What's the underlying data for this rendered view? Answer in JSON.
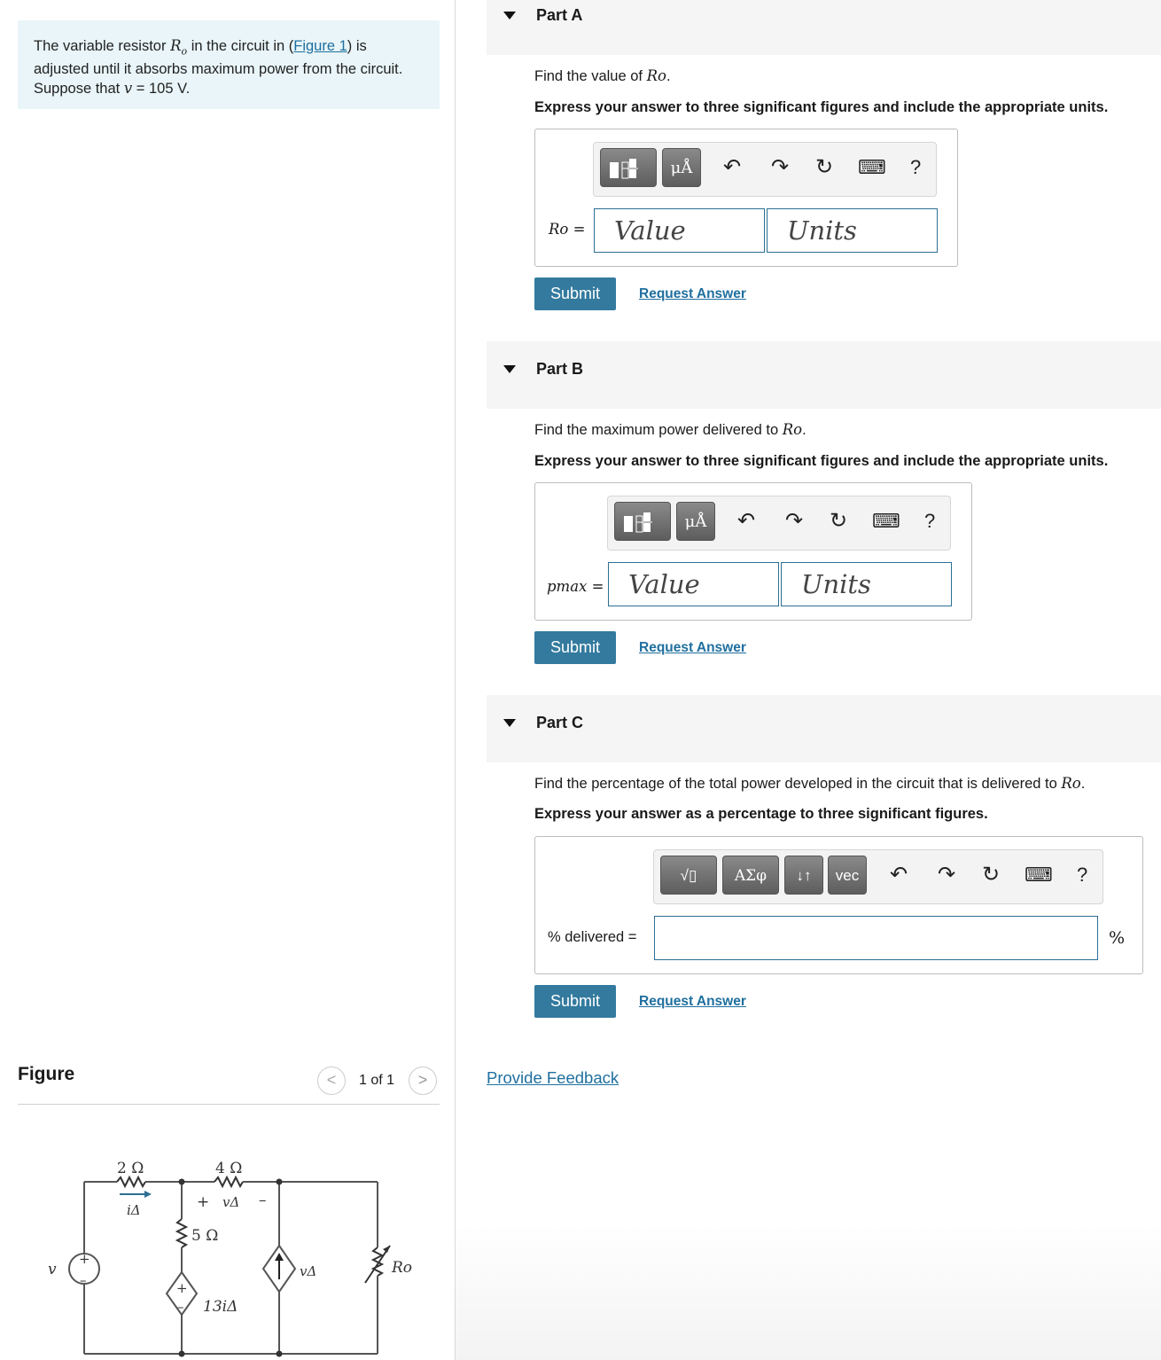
{
  "problem": {
    "text_1": "The variable resistor ",
    "var_R": "R",
    "var_R_sub": "o",
    "text_2": " in the circuit in (",
    "figure_link": "Figure 1",
    "text_3": ") is adjusted until it absorbs maximum power from the circuit. Suppose that ",
    "var_v": "v",
    "text_4": " = 105 V."
  },
  "figure": {
    "title": "Figure",
    "pager": "1 of 1",
    "prev_glyph": "<",
    "next_glyph": ">",
    "labels": {
      "r2": "2 Ω",
      "r4": "4 Ω",
      "r5": "5 Ω",
      "i_delta": "iΔ",
      "v_delta_plus": "+",
      "v_delta": "vΔ",
      "v_delta_minus": "–",
      "dep_src": "13iΔ",
      "v_src": "v",
      "cs_v": "vΔ",
      "ro": "Ro",
      "src_plus": "+",
      "src_minus": "–",
      "dep_plus": "+",
      "dep_minus": "–"
    }
  },
  "parts": [
    {
      "title": "Part A",
      "prompt": "Find the value of ",
      "prompt_var": "Ro",
      "prompt_end": ".",
      "instruction": "Express your answer to three significant figures and include the appropriate units.",
      "var_label": "Ro =",
      "value_placeholder": "Value",
      "units_placeholder": "Units",
      "submit": "Submit",
      "request": "Request Answer"
    },
    {
      "title": "Part B",
      "prompt": "Find the maximum power delivered to ",
      "prompt_var": "Ro",
      "prompt_end": ".",
      "instruction": "Express your answer to three significant figures and include the appropriate units.",
      "var_label": "pmax =",
      "value_placeholder": "Value",
      "units_placeholder": "Units",
      "submit": "Submit",
      "request": "Request Answer"
    },
    {
      "title": "Part C",
      "prompt": "Find the percentage of the total power developed in the circuit that is delivered to ",
      "prompt_var": "Ro",
      "prompt_end": ".",
      "instruction": "Express your answer as a percentage to three significant figures.",
      "var_label": "% delivered =",
      "unit_suffix": "%",
      "submit": "Submit",
      "request": "Request Answer"
    }
  ],
  "toolbar": {
    "units_btn": "μÅ",
    "sqrt_btn": "√▯",
    "greek_btn": "ΑΣφ",
    "arrows_btn": "↓↑",
    "vec_btn": "vec",
    "undo": "↶",
    "redo": "↷",
    "reset": "↻",
    "keyboard": "⌨",
    "help": "?"
  },
  "feedback": "Provide Feedback"
}
